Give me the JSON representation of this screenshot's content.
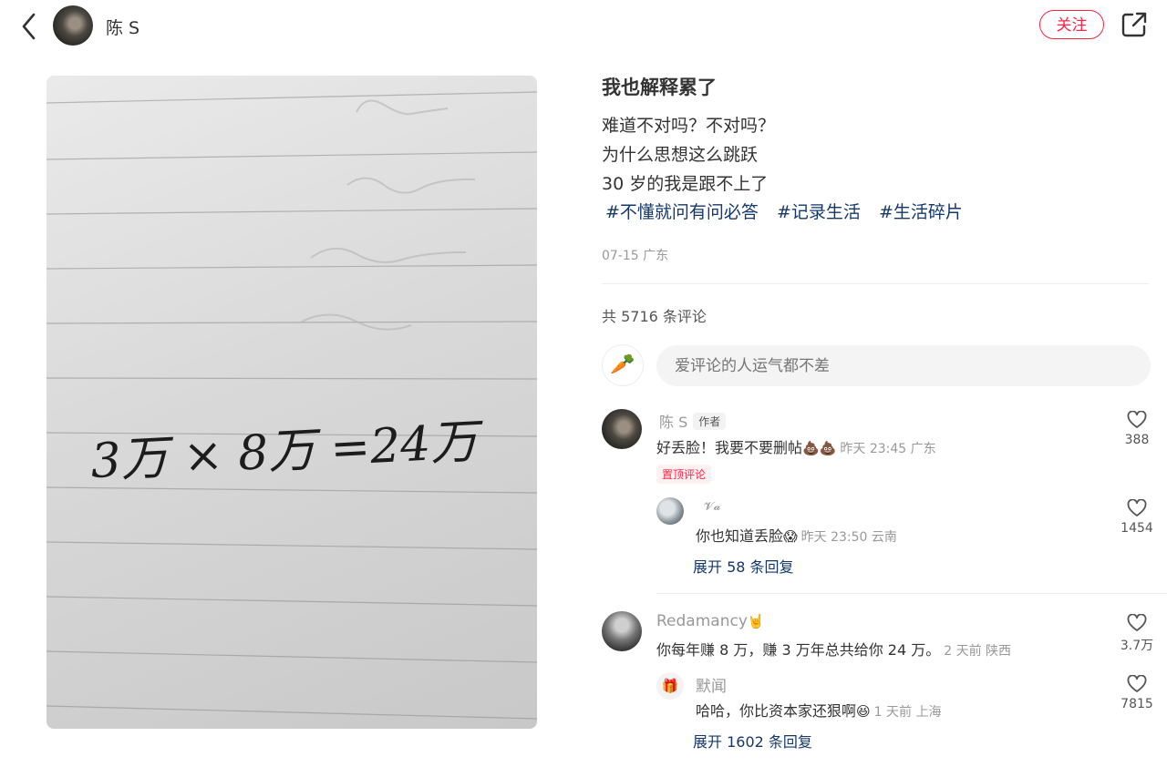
{
  "header": {
    "author_name": "陈 S",
    "follow_label": "关注",
    "icons": {
      "back": "back-icon",
      "share": "share-icon"
    }
  },
  "note": {
    "image_text": "3万 × 8万 =24万",
    "title": "我也解释累了",
    "body_lines": [
      "难道不对吗？不对吗？",
      "为什么思想这么跳跃",
      "30 岁的我是跟不上了"
    ],
    "tags": [
      "#不懂就问有问必答",
      "#记录生活",
      "#生活碎片"
    ],
    "meta": "07-15 广东"
  },
  "comments_section": {
    "count_text": "共 5716 条评论",
    "input_placeholder": "爱评论的人运气都不差",
    "comments": [
      {
        "name": "陈 S",
        "badge": "作者",
        "text": "好丢脸！我要不要删帖",
        "emoji": "💩💩",
        "time": "昨天 23:45 广东",
        "pinned_label": "置顶评论",
        "likes": "388",
        "reply": {
          "name": "𝓥𝓪",
          "text": "你也知道丢脸",
          "emoji": "😱",
          "time": "昨天 23:50 云南",
          "likes": "1454"
        },
        "expand_label": "展开 58 条回复"
      },
      {
        "name": "Redamancy",
        "name_emoji": "🤘",
        "text": "你每年赚 8 万，赚 3 万年总共给你 24 万。",
        "time": "2 天前 陕西",
        "likes": "3.7万",
        "reply": {
          "name": "默闻",
          "text": "哈哈，你比资本家还狠啊",
          "emoji": "😆",
          "time": "1 天前 上海",
          "likes": "7815"
        },
        "expand_label": "展开 1602 条回复"
      }
    ]
  },
  "colors": {
    "accent": "#ff2442",
    "tag_blue": "#13386c",
    "muted": "#999999"
  }
}
